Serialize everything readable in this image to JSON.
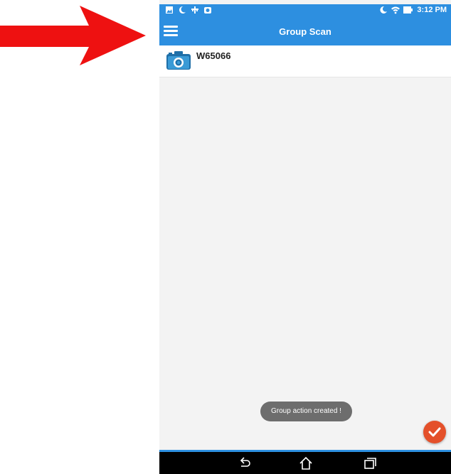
{
  "status_bar": {
    "time": "3:12 PM",
    "left_icons": [
      "image-icon",
      "phone-icon",
      "usb-icon",
      "app-icon"
    ],
    "right_icons": [
      "moon-icon",
      "wifi-icon",
      "battery-icon"
    ]
  },
  "app_bar": {
    "title": "Group Scan",
    "menu_icon": "hamburger-menu-icon"
  },
  "list": {
    "items": [
      {
        "label": "W65066",
        "icon": "camera-icon"
      }
    ]
  },
  "toast": {
    "text": "Group action created !"
  },
  "fab": {
    "icon": "checkmark-icon",
    "color": "#e4502a"
  },
  "nav_bar": {
    "buttons": [
      "back-icon",
      "home-icon",
      "recent-apps-icon"
    ]
  },
  "colors": {
    "primary": "#2d8fe0",
    "annotation_arrow": "#ee1111",
    "toast_bg": "#6d6d6d",
    "fab": "#e4502a"
  }
}
